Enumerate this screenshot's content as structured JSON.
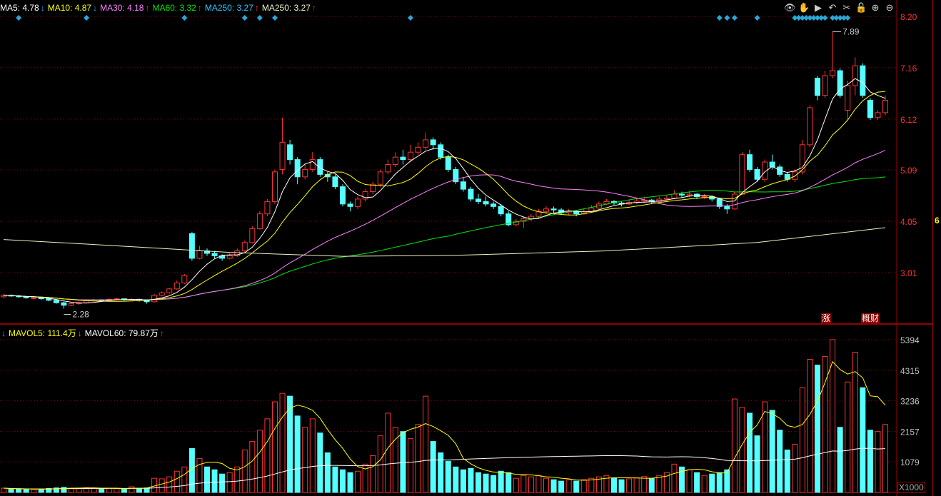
{
  "legend_price": [
    {
      "text": "MA5: 4.78",
      "arrow": "↓",
      "color": "#ffffff",
      "arrow_color": "#29a8ff"
    },
    {
      "text": "MA10: 4.87",
      "arrow": "↓",
      "color": "#ffff00",
      "arrow_color": "#29a8ff"
    },
    {
      "text": "MA30: 4.18",
      "arrow": "↑",
      "color": "#ff80ff",
      "arrow_color": "#ff3030"
    },
    {
      "text": "MA60: 3.32",
      "arrow": "↑",
      "color": "#00e600",
      "arrow_color": "#ff3030"
    },
    {
      "text": "MA250: 3.27",
      "arrow": "↑",
      "color": "#29c8ff",
      "arrow_color": "#ff3030"
    },
    {
      "text": "MA250: 3.27",
      "arrow": "↑",
      "color": "#f0f0c0",
      "arrow_color": "#ff3030"
    }
  ],
  "legend_volume": [
    {
      "text": "",
      "arrow": "↓",
      "color": "#ffff00",
      "arrow_color": "#29a8ff"
    },
    {
      "text": "MAVOL5: 111.4万",
      "arrow": "↓",
      "color": "#ffff00",
      "arrow_color": "#29a8ff"
    },
    {
      "text": "MAVOL60: 79.87万",
      "arrow": "↑",
      "color": "#ffffff",
      "arrow_color": "#ff3030"
    }
  ],
  "toolbar": [
    {
      "icon": "eye-icon",
      "glyph": "👁"
    },
    {
      "icon": "hand-icon",
      "glyph": "✋"
    },
    {
      "icon": "play-icon",
      "glyph": "▶"
    },
    {
      "icon": "undo-icon",
      "glyph": "↶"
    },
    {
      "icon": "scissors-icon",
      "glyph": "✂"
    },
    {
      "icon": "lock-icon",
      "glyph": "🔓"
    },
    {
      "icon": "zoom-in-icon",
      "glyph": "⊕"
    },
    {
      "icon": "zoom-out-icon",
      "glyph": "⊖"
    }
  ],
  "tags": [
    {
      "text": "涨"
    },
    {
      "text": "概财"
    }
  ],
  "side_text": "6",
  "volume_unit": "X1000",
  "colors": {
    "up": "#ff3232",
    "down": "#54ffff",
    "grid": "#8b0000",
    "axis_price": "#ff3030",
    "axis_vol": "#c0c0c0",
    "marker": "#29a8d8"
  },
  "chart_data": {
    "type": "candlestick",
    "price_axis": {
      "ticks": [
        "8.20",
        "7.16",
        "6.12",
        "5.09",
        "4.05",
        "3.01"
      ],
      "range": [
        2.0,
        8.2
      ]
    },
    "volume_axis": {
      "ticks": [
        "5394",
        "4315",
        "3236",
        "2157",
        "1079"
      ],
      "range": [
        0,
        5394
      ],
      "unit": "X1000"
    },
    "annotations": {
      "high": "7.89",
      "high_index": 110,
      "low": "2.28",
      "low_index": 8
    },
    "markers": [
      2,
      11,
      24,
      32,
      34,
      36,
      54,
      95,
      96,
      97,
      100,
      105,
      105.5,
      106,
      106.5,
      107,
      107.5,
      108,
      108.5,
      109,
      110,
      110.5,
      111,
      111.5,
      112
    ],
    "ma250": [
      [
        0,
        3.68
      ],
      [
        12,
        3.58
      ],
      [
        30,
        3.42
      ],
      [
        45,
        3.34
      ],
      [
        60,
        3.36
      ],
      [
        80,
        3.45
      ],
      [
        100,
        3.62
      ],
      [
        117,
        3.92
      ]
    ],
    "candles_ohlcv": [
      [
        2.52,
        2.58,
        2.5,
        2.55,
        150
      ],
      [
        2.55,
        2.57,
        2.52,
        2.54,
        130
      ],
      [
        2.54,
        2.56,
        2.5,
        2.52,
        120
      ],
      [
        2.52,
        2.54,
        2.48,
        2.5,
        110
      ],
      [
        2.5,
        2.53,
        2.47,
        2.5,
        100
      ],
      [
        2.5,
        2.52,
        2.46,
        2.48,
        120
      ],
      [
        2.48,
        2.49,
        2.43,
        2.45,
        140
      ],
      [
        2.45,
        2.46,
        2.38,
        2.4,
        160
      ],
      [
        2.4,
        2.42,
        2.28,
        2.35,
        180
      ],
      [
        2.35,
        2.4,
        2.33,
        2.38,
        150
      ],
      [
        2.38,
        2.42,
        2.36,
        2.4,
        140
      ],
      [
        2.4,
        2.46,
        2.39,
        2.44,
        170
      ],
      [
        2.44,
        2.48,
        2.42,
        2.46,
        160
      ],
      [
        2.46,
        2.47,
        2.43,
        2.45,
        130
      ],
      [
        2.45,
        2.49,
        2.44,
        2.47,
        150
      ],
      [
        2.47,
        2.5,
        2.45,
        2.48,
        140
      ],
      [
        2.48,
        2.49,
        2.44,
        2.46,
        120
      ],
      [
        2.46,
        2.49,
        2.45,
        2.47,
        200
      ],
      [
        2.47,
        2.48,
        2.42,
        2.45,
        150
      ],
      [
        2.45,
        2.46,
        2.38,
        2.42,
        160
      ],
      [
        2.42,
        2.58,
        2.41,
        2.55,
        500
      ],
      [
        2.55,
        2.63,
        2.53,
        2.6,
        480
      ],
      [
        2.6,
        2.7,
        2.58,
        2.68,
        550
      ],
      [
        2.68,
        2.85,
        2.66,
        2.8,
        750
      ],
      [
        2.8,
        2.98,
        2.78,
        2.95,
        900
      ],
      [
        3.8,
        3.83,
        3.25,
        3.3,
        1550
      ],
      [
        3.3,
        3.55,
        3.28,
        3.45,
        1200
      ],
      [
        3.45,
        3.5,
        3.35,
        3.4,
        900
      ],
      [
        3.4,
        3.45,
        3.3,
        3.35,
        800
      ],
      [
        3.35,
        3.38,
        3.25,
        3.3,
        650
      ],
      [
        3.3,
        3.4,
        3.28,
        3.35,
        700
      ],
      [
        3.35,
        3.5,
        3.33,
        3.45,
        900
      ],
      [
        3.45,
        3.66,
        3.43,
        3.62,
        1500
      ],
      [
        3.62,
        3.95,
        3.6,
        3.9,
        1800
      ],
      [
        3.9,
        4.25,
        3.88,
        4.2,
        2200
      ],
      [
        4.2,
        4.5,
        4.15,
        4.45,
        2600
      ],
      [
        4.45,
        5.1,
        4.4,
        5.05,
        3200
      ],
      [
        5.1,
        6.15,
        5.0,
        5.65,
        3500
      ],
      [
        5.6,
        5.7,
        5.2,
        5.3,
        3400
      ],
      [
        5.3,
        5.35,
        4.8,
        4.95,
        2700
      ],
      [
        4.95,
        5.2,
        4.9,
        5.1,
        2300
      ],
      [
        5.1,
        5.45,
        5.05,
        5.3,
        2600
      ],
      [
        5.3,
        5.35,
        4.95,
        5.0,
        2100
      ],
      [
        5.0,
        5.05,
        4.85,
        4.95,
        1400
      ],
      [
        4.95,
        5.0,
        4.7,
        4.75,
        900
      ],
      [
        4.75,
        4.8,
        4.35,
        4.4,
        800
      ],
      [
        4.4,
        4.45,
        4.25,
        4.35,
        700
      ],
      [
        4.35,
        4.55,
        4.3,
        4.5,
        750
      ],
      [
        4.5,
        4.7,
        4.45,
        4.65,
        1000
      ],
      [
        4.65,
        4.85,
        4.6,
        4.8,
        1300
      ],
      [
        4.8,
        5.1,
        4.75,
        5.05,
        2000
      ],
      [
        5.05,
        5.3,
        5.0,
        5.2,
        2800
      ],
      [
        5.2,
        5.45,
        5.15,
        5.35,
        2300
      ],
      [
        5.35,
        5.5,
        5.2,
        5.3,
        2150
      ],
      [
        5.3,
        5.6,
        5.25,
        5.45,
        1900
      ],
      [
        5.45,
        5.65,
        5.4,
        5.55,
        2400
      ],
      [
        5.55,
        5.85,
        5.5,
        5.7,
        3400
      ],
      [
        5.7,
        5.75,
        5.5,
        5.6,
        1800
      ],
      [
        5.6,
        5.65,
        5.3,
        5.35,
        1400
      ],
      [
        5.35,
        5.4,
        5.05,
        5.1,
        1100
      ],
      [
        5.1,
        5.15,
        4.8,
        4.85,
        900
      ],
      [
        4.85,
        4.95,
        4.65,
        4.7,
        800
      ],
      [
        4.7,
        4.75,
        4.45,
        4.5,
        850
      ],
      [
        4.5,
        4.6,
        4.4,
        4.45,
        700
      ],
      [
        4.45,
        4.55,
        4.35,
        4.4,
        650
      ],
      [
        4.4,
        4.45,
        4.3,
        4.35,
        600
      ],
      [
        4.35,
        4.4,
        4.15,
        4.2,
        750
      ],
      [
        4.2,
        4.25,
        3.95,
        3.98,
        700
      ],
      [
        3.98,
        4.1,
        3.95,
        4.05,
        500
      ],
      [
        4.05,
        4.15,
        3.92,
        4.1,
        600
      ],
      [
        4.1,
        4.2,
        4.05,
        4.15,
        550
      ],
      [
        4.15,
        4.3,
        4.1,
        4.25,
        600
      ],
      [
        4.25,
        4.35,
        4.2,
        4.3,
        500
      ],
      [
        4.3,
        4.35,
        4.22,
        4.28,
        450
      ],
      [
        4.28,
        4.32,
        4.18,
        4.22,
        400
      ],
      [
        4.22,
        4.3,
        4.18,
        4.25,
        450
      ],
      [
        4.25,
        4.28,
        4.15,
        4.2,
        400
      ],
      [
        4.2,
        4.3,
        4.18,
        4.25,
        450
      ],
      [
        4.25,
        4.38,
        4.22,
        4.32,
        500
      ],
      [
        4.32,
        4.45,
        4.3,
        4.4,
        550
      ],
      [
        4.4,
        4.5,
        4.38,
        4.45,
        600
      ],
      [
        4.45,
        4.48,
        4.38,
        4.42,
        500
      ],
      [
        4.42,
        4.46,
        4.35,
        4.4,
        450
      ],
      [
        4.4,
        4.48,
        4.38,
        4.43,
        480
      ],
      [
        4.43,
        4.52,
        4.4,
        4.46,
        520
      ],
      [
        4.46,
        4.55,
        4.42,
        4.48,
        560
      ],
      [
        4.48,
        4.5,
        4.4,
        4.45,
        500
      ],
      [
        4.45,
        4.55,
        4.43,
        4.5,
        600
      ],
      [
        4.5,
        4.58,
        4.46,
        4.52,
        700
      ],
      [
        4.52,
        4.68,
        4.5,
        4.6,
        1000
      ],
      [
        4.6,
        4.65,
        4.52,
        4.58,
        900
      ],
      [
        4.58,
        4.66,
        4.54,
        4.6,
        800
      ],
      [
        4.6,
        4.62,
        4.5,
        4.55,
        700
      ],
      [
        4.55,
        4.6,
        4.5,
        4.55,
        600
      ],
      [
        4.55,
        4.58,
        4.45,
        4.5,
        650
      ],
      [
        4.5,
        4.52,
        4.3,
        4.35,
        700
      ],
      [
        4.35,
        4.4,
        4.2,
        4.3,
        800
      ],
      [
        4.3,
        4.65,
        4.28,
        4.6,
        3300
      ],
      [
        4.6,
        5.45,
        4.58,
        5.4,
        3000
      ],
      [
        5.4,
        5.5,
        5.05,
        5.1,
        2800
      ],
      [
        5.1,
        5.15,
        4.85,
        4.9,
        2000
      ],
      [
        4.9,
        5.3,
        4.85,
        5.25,
        3200
      ],
      [
        5.25,
        5.4,
        5.1,
        5.15,
        2900
      ],
      [
        5.15,
        5.2,
        4.95,
        5.0,
        2200
      ],
      [
        5.0,
        5.05,
        4.85,
        4.9,
        1500
      ],
      [
        4.9,
        5.1,
        4.85,
        5.05,
        1700
      ],
      [
        5.05,
        5.7,
        5.0,
        5.6,
        3700
      ],
      [
        5.6,
        6.4,
        5.55,
        6.35,
        4700
      ],
      [
        6.95,
        7.0,
        6.5,
        6.6,
        4500
      ],
      [
        6.6,
        7.1,
        6.55,
        7.0,
        4800
      ],
      [
        7.0,
        7.89,
        6.95,
        7.1,
        5394
      ],
      [
        7.1,
        7.15,
        6.55,
        6.6,
        2300
      ],
      [
        6.3,
        6.9,
        6.1,
        6.8,
        3900
      ],
      [
        6.8,
        7.37,
        6.6,
        7.2,
        4950
      ],
      [
        7.2,
        7.25,
        6.55,
        6.6,
        3700
      ],
      [
        6.5,
        6.55,
        6.1,
        6.15,
        2200
      ],
      [
        6.15,
        6.3,
        6.1,
        6.25,
        2150
      ],
      [
        6.25,
        6.6,
        6.2,
        6.5,
        2400
      ]
    ]
  }
}
